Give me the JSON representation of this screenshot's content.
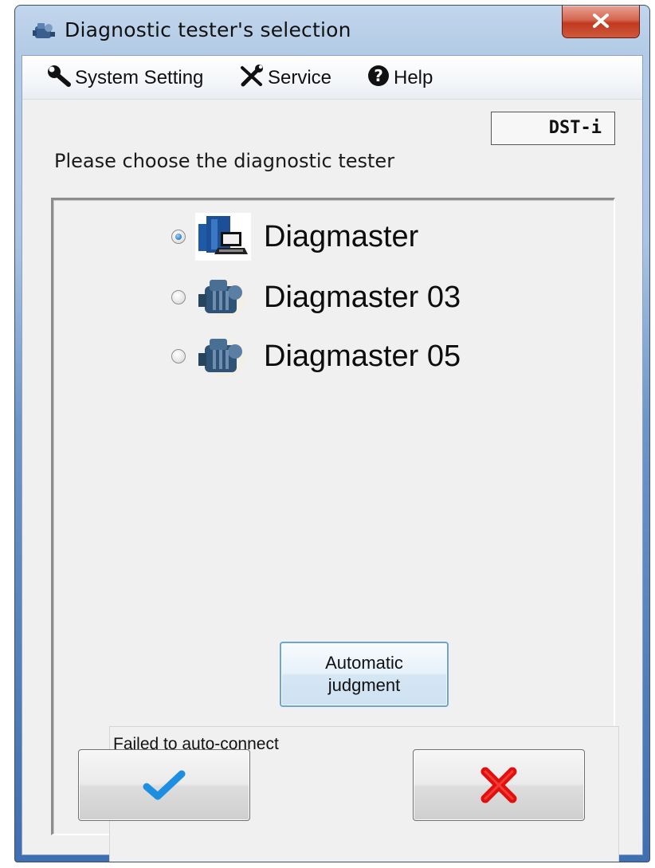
{
  "window": {
    "title": "Diagnostic tester's selection"
  },
  "menu": {
    "items": [
      {
        "label": "System Setting",
        "icon": "wrench-icon"
      },
      {
        "label": "Service",
        "icon": "tools-icon"
      },
      {
        "label": "Help",
        "icon": "help-icon"
      }
    ]
  },
  "device_tag": "DST-i",
  "prompt": "Please choose the diagnostic tester",
  "options": [
    {
      "label": "Diagmaster",
      "selected": true,
      "icon": "diagmaster-laptop-icon"
    },
    {
      "label": "Diagmaster 03",
      "selected": false,
      "icon": "engine-icon"
    },
    {
      "label": "Diagmaster 05",
      "selected": false,
      "icon": "engine-icon"
    }
  ],
  "auto_button": {
    "line1": "Automatic",
    "line2": "judgment"
  },
  "status_text": "Failed to auto-connect",
  "buttons": {
    "ok_icon": "checkmark-icon",
    "cancel_icon": "red-x-icon"
  },
  "colors": {
    "checkmark": "#1e8fe0",
    "cancel_x": "#e01010",
    "close_button": "#c7442a",
    "frame": "#6d96c8"
  }
}
